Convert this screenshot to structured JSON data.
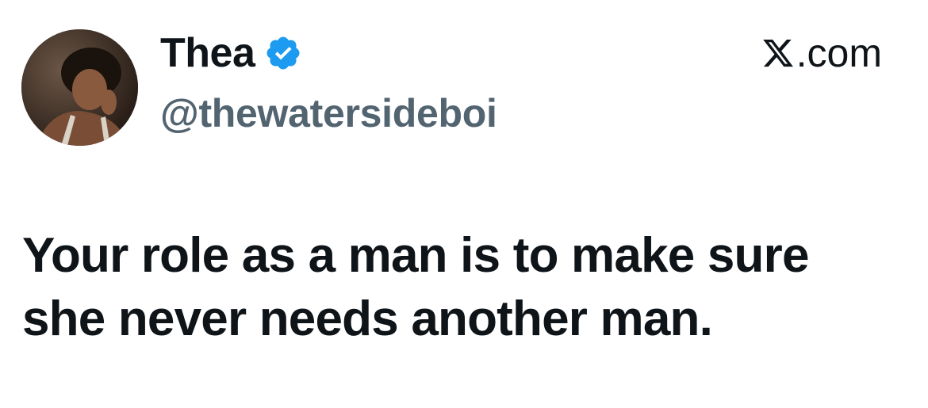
{
  "author": {
    "display_name": "Thea",
    "handle": "@thewatersideboi",
    "verified": true,
    "verified_color": "#1d9bf0"
  },
  "brand": {
    "label": ".com",
    "icon": "x-logo-icon"
  },
  "tweet": {
    "text": "Your role as a man is to make sure she never needs another man."
  },
  "colors": {
    "text_primary": "#0f1419",
    "text_secondary": "#536471",
    "background": "#ffffff"
  }
}
